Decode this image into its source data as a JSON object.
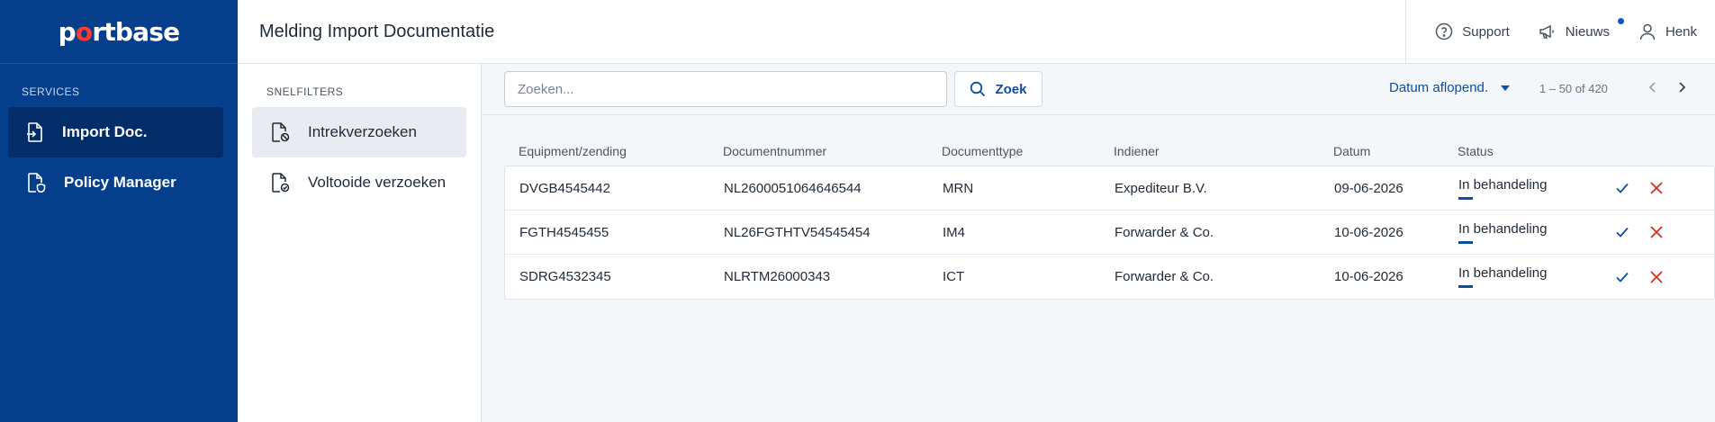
{
  "brand": {
    "logo_pre": "p",
    "logo_o": "o",
    "logo_post": "rtbase"
  },
  "sidebar": {
    "section_label": "SERVICES",
    "items": [
      {
        "label": "Import Doc.",
        "icon": "import-document-icon",
        "active": true
      },
      {
        "label": "Policy Manager",
        "icon": "policy-shield-icon",
        "active": false
      }
    ]
  },
  "header": {
    "title": "Melding Import Documentatie",
    "support_label": "Support",
    "news_label": "Nieuws",
    "user_label": "Henk"
  },
  "filters": {
    "section_label": "SNELFILTERS",
    "items": [
      {
        "label": "Intrekverzoeken",
        "icon": "document-cancel-icon",
        "active": true
      },
      {
        "label": "Voltooide verzoeken",
        "icon": "document-check-icon",
        "active": false
      }
    ]
  },
  "toolbar": {
    "search_placeholder": "Zoeken...",
    "search_button": "Zoek",
    "sort_label": "Datum aflopend.",
    "pager_text": "1 – 50 of 420"
  },
  "table": {
    "columns": [
      "Equipment/zending",
      "Documentnummer",
      "Documenttype",
      "Indiener",
      "Datum",
      "Status"
    ],
    "rows": [
      [
        "DVGB4545442",
        "NL2600051064646544",
        "MRN",
        "Expediteur B.V.",
        "09-06-2026",
        "In behandeling"
      ],
      [
        "FGTH4545455",
        "NL26FGTHTV54545454",
        "IM4",
        "Forwarder & Co.",
        "10-06-2026",
        "In behandeling"
      ],
      [
        "SDRG4532345",
        "NLRTM26000343",
        "ICT",
        "Forwarder & Co.",
        "10-06-2026",
        "In behandeling"
      ]
    ]
  },
  "colors": {
    "sidebar_bg": "#053f8c",
    "sidebar_active": "#022d68",
    "accent": "#0b4ea2",
    "reject": "#d92d20",
    "logo_o": "#ff3b30"
  }
}
